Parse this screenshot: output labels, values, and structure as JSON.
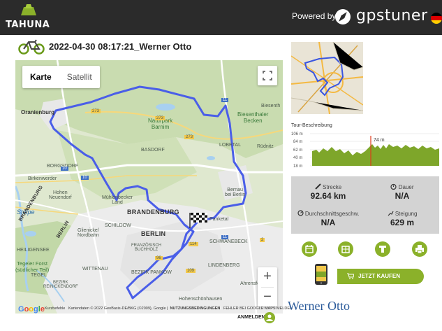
{
  "header": {
    "logo_text": "TAHUNA",
    "powered_by": "Powered by",
    "brand": "gpstuner",
    "brand_mark": "®",
    "flag": "german-flag",
    "colors": {
      "bar": "#2b2b2b",
      "accent": "#8bb12a"
    }
  },
  "tour": {
    "title": "2022-04-30 08:17:21_Werner Otto",
    "icon": "bicycle-icon"
  },
  "map": {
    "type_buttons": [
      "Karte",
      "Satellit"
    ],
    "active_type": "Karte",
    "labels": {
      "oranienburg": "Oranienburg",
      "naturpark": "Naturpark",
      "barnim": "Barnim",
      "biesenthal": "Biesenthaler",
      "becken": "Becken",
      "biesenth": "Biesenth",
      "basdorf": "BASDORF",
      "lobetal": "LOBETAL",
      "rudnitz": "Rüdnitz",
      "borgsdorf": "BORGSDORF",
      "birkenwerder": "Birkenwerder",
      "hohen_neuendorf": "Hohen\nNeuendorf",
      "muehlenbeck": "Mühlenbecker\nLand",
      "bernau": "Bernau\nbei Berlin",
      "brandenburg": "BRANDENBURG",
      "stolpe": "Stolpe",
      "brandenburg_diag": "BRANDENBURG",
      "schildow": "SCHILDOW",
      "glienicke": "Glienicke/\nNordbahn",
      "berlin_diag": "BERLIN",
      "berlin": "BERLIN",
      "panketal": "Panketal",
      "schwanebeck": "SCHWANEBECK",
      "heiligensee": "HEILIGENSEE",
      "franz_buchholz": "FRANZÖSISCH\nBUCHHOLZ",
      "tegeler_forst": "Tegeler Forst\n(südlicher Teil)",
      "wittenau": "WITTENAU",
      "bezirk_pankow": "BEZIRK PANKOW",
      "tegel": "TEGEL",
      "bezirk_reinickendorf": "BEZIRK\nREINICKENDORF",
      "lindenberg": "LINDENBERG",
      "ahrensfelde": "Ahrensfelde",
      "hohenschoenhausen": "Hohenschönhausen",
      "road_273a": "273",
      "road_273b": "273",
      "road_273c": "273",
      "road_11a": "11",
      "road_11b": "11",
      "road_10a": "10",
      "road_10b": "10",
      "road_96": "96",
      "road_114": "114",
      "road_109": "109",
      "road_2": "2"
    },
    "zoom_in": "+",
    "zoom_out": "−",
    "google": "Google",
    "attribution": {
      "shortcuts": "Kurzbefehle",
      "data": "Kartendaten © 2022 GeoBasis-DE/BKG (©2009), Google",
      "terms": "NUTZUNGSBEDINGUNGEN",
      "report": "FEHLER BEI GOOGLE MAPS MELDEN"
    }
  },
  "sidebar": {
    "tour_label": "Tour-Beschreibung",
    "elevation": {
      "y_ticks": [
        "106 m",
        "84 m",
        "62 m",
        "40 m",
        "18 m"
      ],
      "marker_label": "74 m"
    },
    "stats": {
      "distance_label": "Strecke",
      "distance_value": "92.64 km",
      "duration_label": "Dauer",
      "duration_value": "N/A",
      "avg_speed_label": "Durchschnittsgeschw.",
      "avg_speed_value": "N/A",
      "climb_label": "Steigung",
      "climb_value": "629 m"
    },
    "actions": [
      "calendar-icon",
      "calendar-grid-icon",
      "download-t-icon",
      "print-icon"
    ],
    "buy_label": "JETZT KAUFEN"
  },
  "footer": {
    "owner": "Werner Otto",
    "login": "ANMELDEN"
  }
}
